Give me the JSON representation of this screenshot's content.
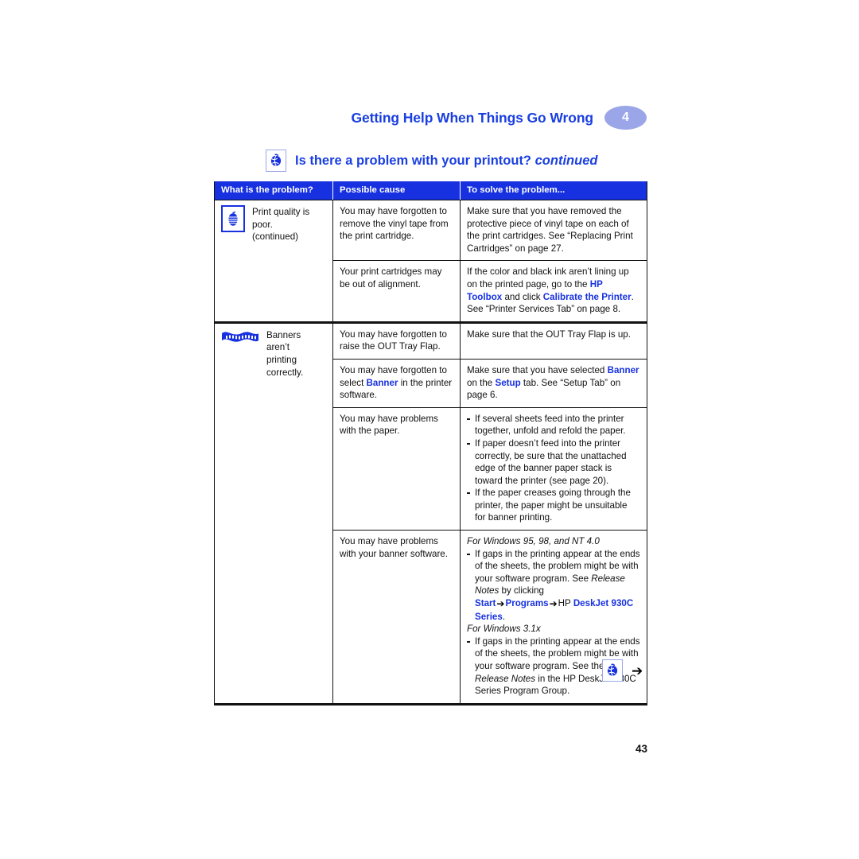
{
  "running_head": {
    "title": "Getting Help When Things Go Wrong",
    "chapter_number": "4"
  },
  "section": {
    "icon": "globe-icon",
    "title": "Is there a problem with your printout?",
    "continued": "continued"
  },
  "table": {
    "headers": {
      "col1": "What is the problem?",
      "col2": "Possible cause",
      "col3": "To solve the problem..."
    },
    "rows": [
      {
        "problem_icon": "apple-print-quality-icon",
        "problem_line1": "Print quality is poor.",
        "problem_line2": "(continued)",
        "cause": "You may have forgotten to remove the vinyl tape from the print cartridge.",
        "solution": "Make sure that you have removed the protective piece of vinyl tape on each of the print cartridges. See “Replacing Print Cartridges” on page 27."
      },
      {
        "cause": "Your print cartridges may be out of alignment.",
        "solution_pre": "If the color and black ink aren’t lining up on the printed page, go to the ",
        "solution_link1": "HP Toolbox",
        "solution_mid": " and click ",
        "solution_link2": "Calibrate the Printer",
        "solution_post": ". See “Printer Services Tab” on page 8."
      },
      {
        "problem_icon": "banner-icon",
        "problem_line1": "Banners aren’t",
        "problem_line2": "printing",
        "problem_line3": "correctly.",
        "cause": "You may have forgotten to raise the OUT Tray Flap.",
        "solution": "Make sure that the OUT Tray Flap is up."
      },
      {
        "cause_pre": "You may have forgotten to select ",
        "cause_link": "Banner",
        "cause_post": " in the printer software.",
        "solution_pre": "Make sure that you have selected ",
        "solution_link1": "Banner",
        "solution_mid": " on the ",
        "solution_link2": "Setup",
        "solution_post": " tab. See “Setup Tab” on page 6."
      },
      {
        "cause": "You may have problems with the paper.",
        "solution_bullets": [
          "If several sheets feed into the printer together, unfold and refold the paper.",
          "If paper doesn’t feed into the printer correctly, be sure that the unattached edge of the banner paper stack is toward the printer (see page 20).",
          "If the paper creases going through the printer, the paper might be unsuitable for banner printing."
        ]
      },
      {
        "cause": "You may have problems with your banner software.",
        "win_group_1": {
          "heading": "For Windows 95, 98, and NT 4.0",
          "text_pre": "If gaps in the printing appear at the ends of the sheets, the problem might be with your software program. See ",
          "italic_ref": "Release Notes",
          "text_mid": " by clicking ",
          "link_start": "Start",
          "arrow": "➔",
          "link_programs": "Programs",
          "text_hp": "HP",
          "link_deskjet": "DeskJet 930C Series",
          "text_end": "."
        },
        "win_group_2": {
          "heading": "For Windows 3.1x",
          "text_pre": "If gaps in the printing appear at the ends of the sheets, the problem might be with your software program. See the ",
          "italic_ref": "Release Notes",
          "text_post": " in the HP DeskJet 930C Series Program Group."
        }
      }
    ]
  },
  "footer": {
    "nav_icon": "globe-icon",
    "next_arrow": "➔",
    "page_number": "43"
  },
  "colors": {
    "brand_blue": "#1731e0",
    "header_blue": "#1a3fe0",
    "badge_blue": "#9aa6e8",
    "rule_black": "#111111"
  }
}
